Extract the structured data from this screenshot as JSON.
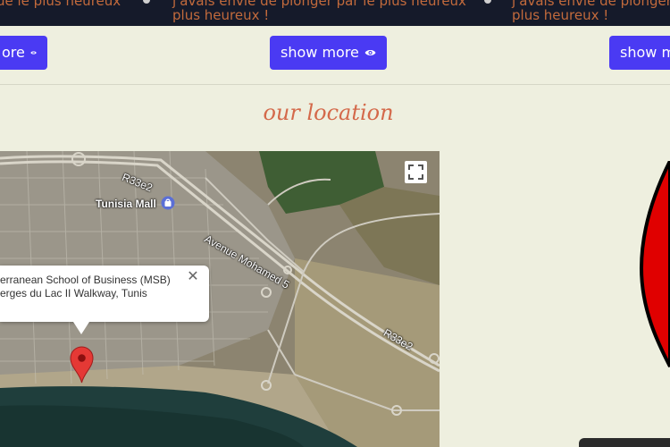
{
  "top_strip": {
    "left_text": "ue le plus heureux",
    "middle_text_1": "j'avais envie de plonger par le plus heureux",
    "middle_text_2": "plus heureux !",
    "right_text_1": "j'avais envie de plonger",
    "right_text_2": "plus heureux !"
  },
  "buttons": {
    "left_label": "ore",
    "middle_label": "show more",
    "right_label": "show m"
  },
  "section": {
    "title": "our location"
  },
  "map": {
    "mall_label": "Tunisia Mall",
    "road_1": "R33e2",
    "road_2": "Avenue Mohamed 5",
    "road_3": "R33e2",
    "info_line_1": "erranean School of Business (MSB)",
    "info_line_2": "erges du Lac II Walkway, Tunis",
    "close_symbol": "✕"
  },
  "colors": {
    "button": "#4a3af3",
    "heading": "#d4694a",
    "marker": "#e53935",
    "page_bg": "#eeefdf",
    "top_bar": "#151a2a"
  }
}
